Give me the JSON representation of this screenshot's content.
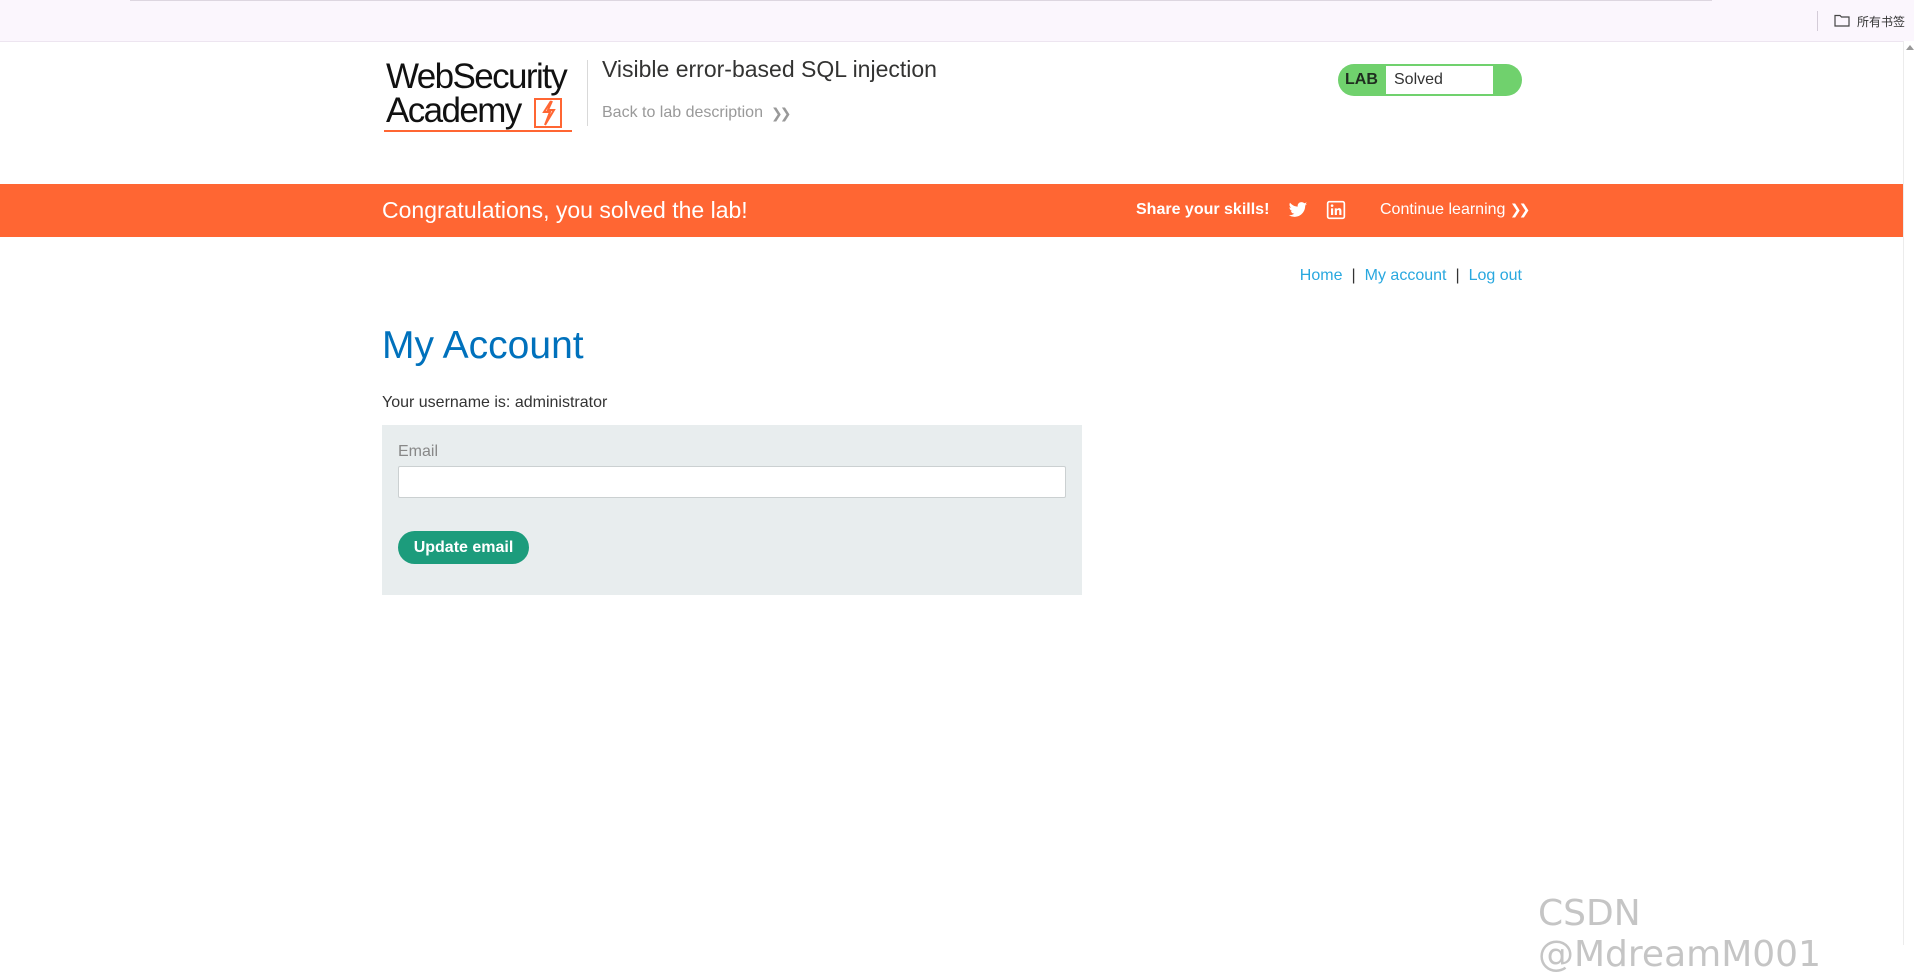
{
  "browser": {
    "bookmarks_label": "所有书签"
  },
  "header": {
    "logo_line1": "WebSecurity",
    "logo_line2": "Academy",
    "lab_title": "Visible error-based SQL injection",
    "back_link": "Back to lab description",
    "status_tag": "LAB",
    "status_value": "Solved",
    "status_color": "#70d16d"
  },
  "banner": {
    "message": "Congratulations, you solved the lab!",
    "share_label": "Share your skills!",
    "continue_label": "Continue learning",
    "color": "#ff6633",
    "icons": [
      "twitter-icon",
      "linkedin-icon"
    ]
  },
  "nav": {
    "home": "Home",
    "my_account": "My account",
    "log_out": "Log out",
    "separator": "|"
  },
  "content": {
    "heading": "My Account",
    "username_line": "Your username is: administrator",
    "email_label": "Email",
    "email_value": "",
    "update_button": "Update email",
    "button_color": "#1c9c7c"
  },
  "watermark": "CSDN @MdreamM001"
}
